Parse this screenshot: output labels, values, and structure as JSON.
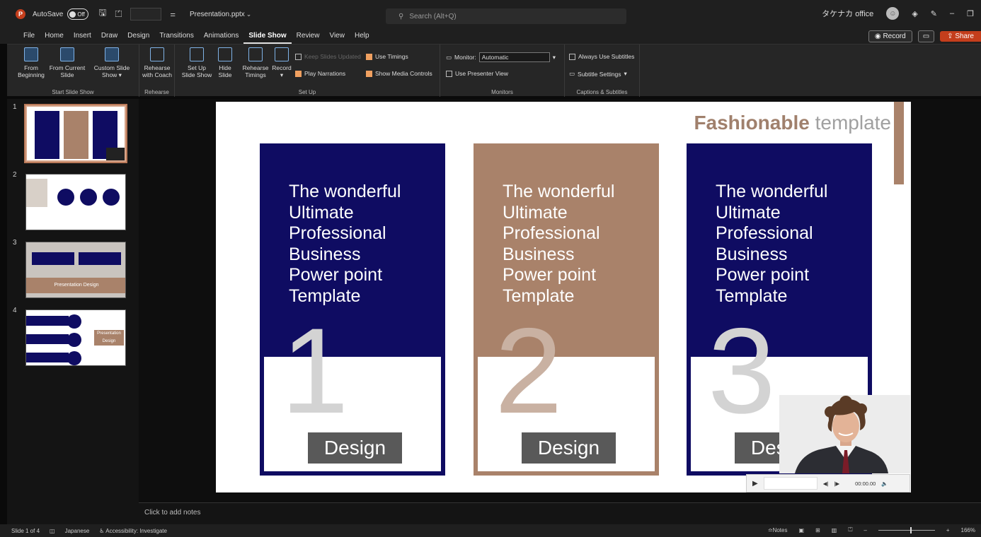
{
  "titlebar": {
    "autosave_label": "AutoSave",
    "autosave_state": "Off",
    "filename": "Presentation.pptx",
    "search_placeholder": "Search (Alt+Q)",
    "account": "タケナカ office"
  },
  "menubar": {
    "items": [
      "File",
      "Home",
      "Insert",
      "Draw",
      "Design",
      "Transitions",
      "Animations",
      "Slide Show",
      "Review",
      "View",
      "Help"
    ],
    "active": "Slide Show",
    "record_label": "Record",
    "share_label": "Share"
  },
  "ribbon": {
    "start": {
      "group_label": "Start Slide Show",
      "from_beginning": "From Beginning",
      "from_current": "From Current Slide",
      "custom": "Custom Slide Show"
    },
    "rehearse": {
      "group_label": "Rehearse",
      "rehearse_coach": "Rehearse with Coach"
    },
    "setup": {
      "group_label": "Set Up",
      "setup_show": "Set Up Slide Show",
      "hide_slide": "Hide Slide",
      "rehearse_timings": "Rehearse Timings",
      "record": "Record",
      "keep_updated": "Keep Slides Updated",
      "play_narrations": "Play Narrations",
      "use_timings": "Use Timings",
      "show_media": "Show Media Controls"
    },
    "monitors": {
      "group_label": "Monitors",
      "monitor_label": "Monitor:",
      "monitor_value": "Automatic",
      "presenter_view": "Use Presenter View"
    },
    "captions": {
      "group_label": "Captions & Subtitles",
      "always_subtitles": "Always Use Subtitles",
      "subtitle_settings": "Subtitle Settings"
    }
  },
  "thumbnails": {
    "numbers": [
      "1",
      "2",
      "3",
      "4"
    ],
    "slide3_caption": "Presentation Design",
    "slide4_caption": "Presentation Design"
  },
  "slide": {
    "title_bold": "Fashionable",
    "title_light": "template",
    "card_text": [
      "The wonderful",
      "Ultimate",
      "Professional",
      "Business",
      "Power point",
      "Template"
    ],
    "cards": [
      {
        "number": "1",
        "label": "Design",
        "color": "#0f0c62",
        "num_color": "#d3d3d3"
      },
      {
        "number": "2",
        "label": "Design",
        "color": "#a9826a",
        "num_color": "#c9b1a2"
      },
      {
        "number": "3",
        "label": "Design",
        "color": "#0f0c62",
        "num_color": "#d3d3d3"
      }
    ]
  },
  "video": {
    "time": "00:00.00"
  },
  "notes": {
    "placeholder": "Click to add notes"
  },
  "statusbar": {
    "slide_info": "Slide 1 of 4",
    "language": "Japanese",
    "accessibility": "Accessibility: Investigate",
    "notes": "Notes",
    "zoom": "166%"
  }
}
